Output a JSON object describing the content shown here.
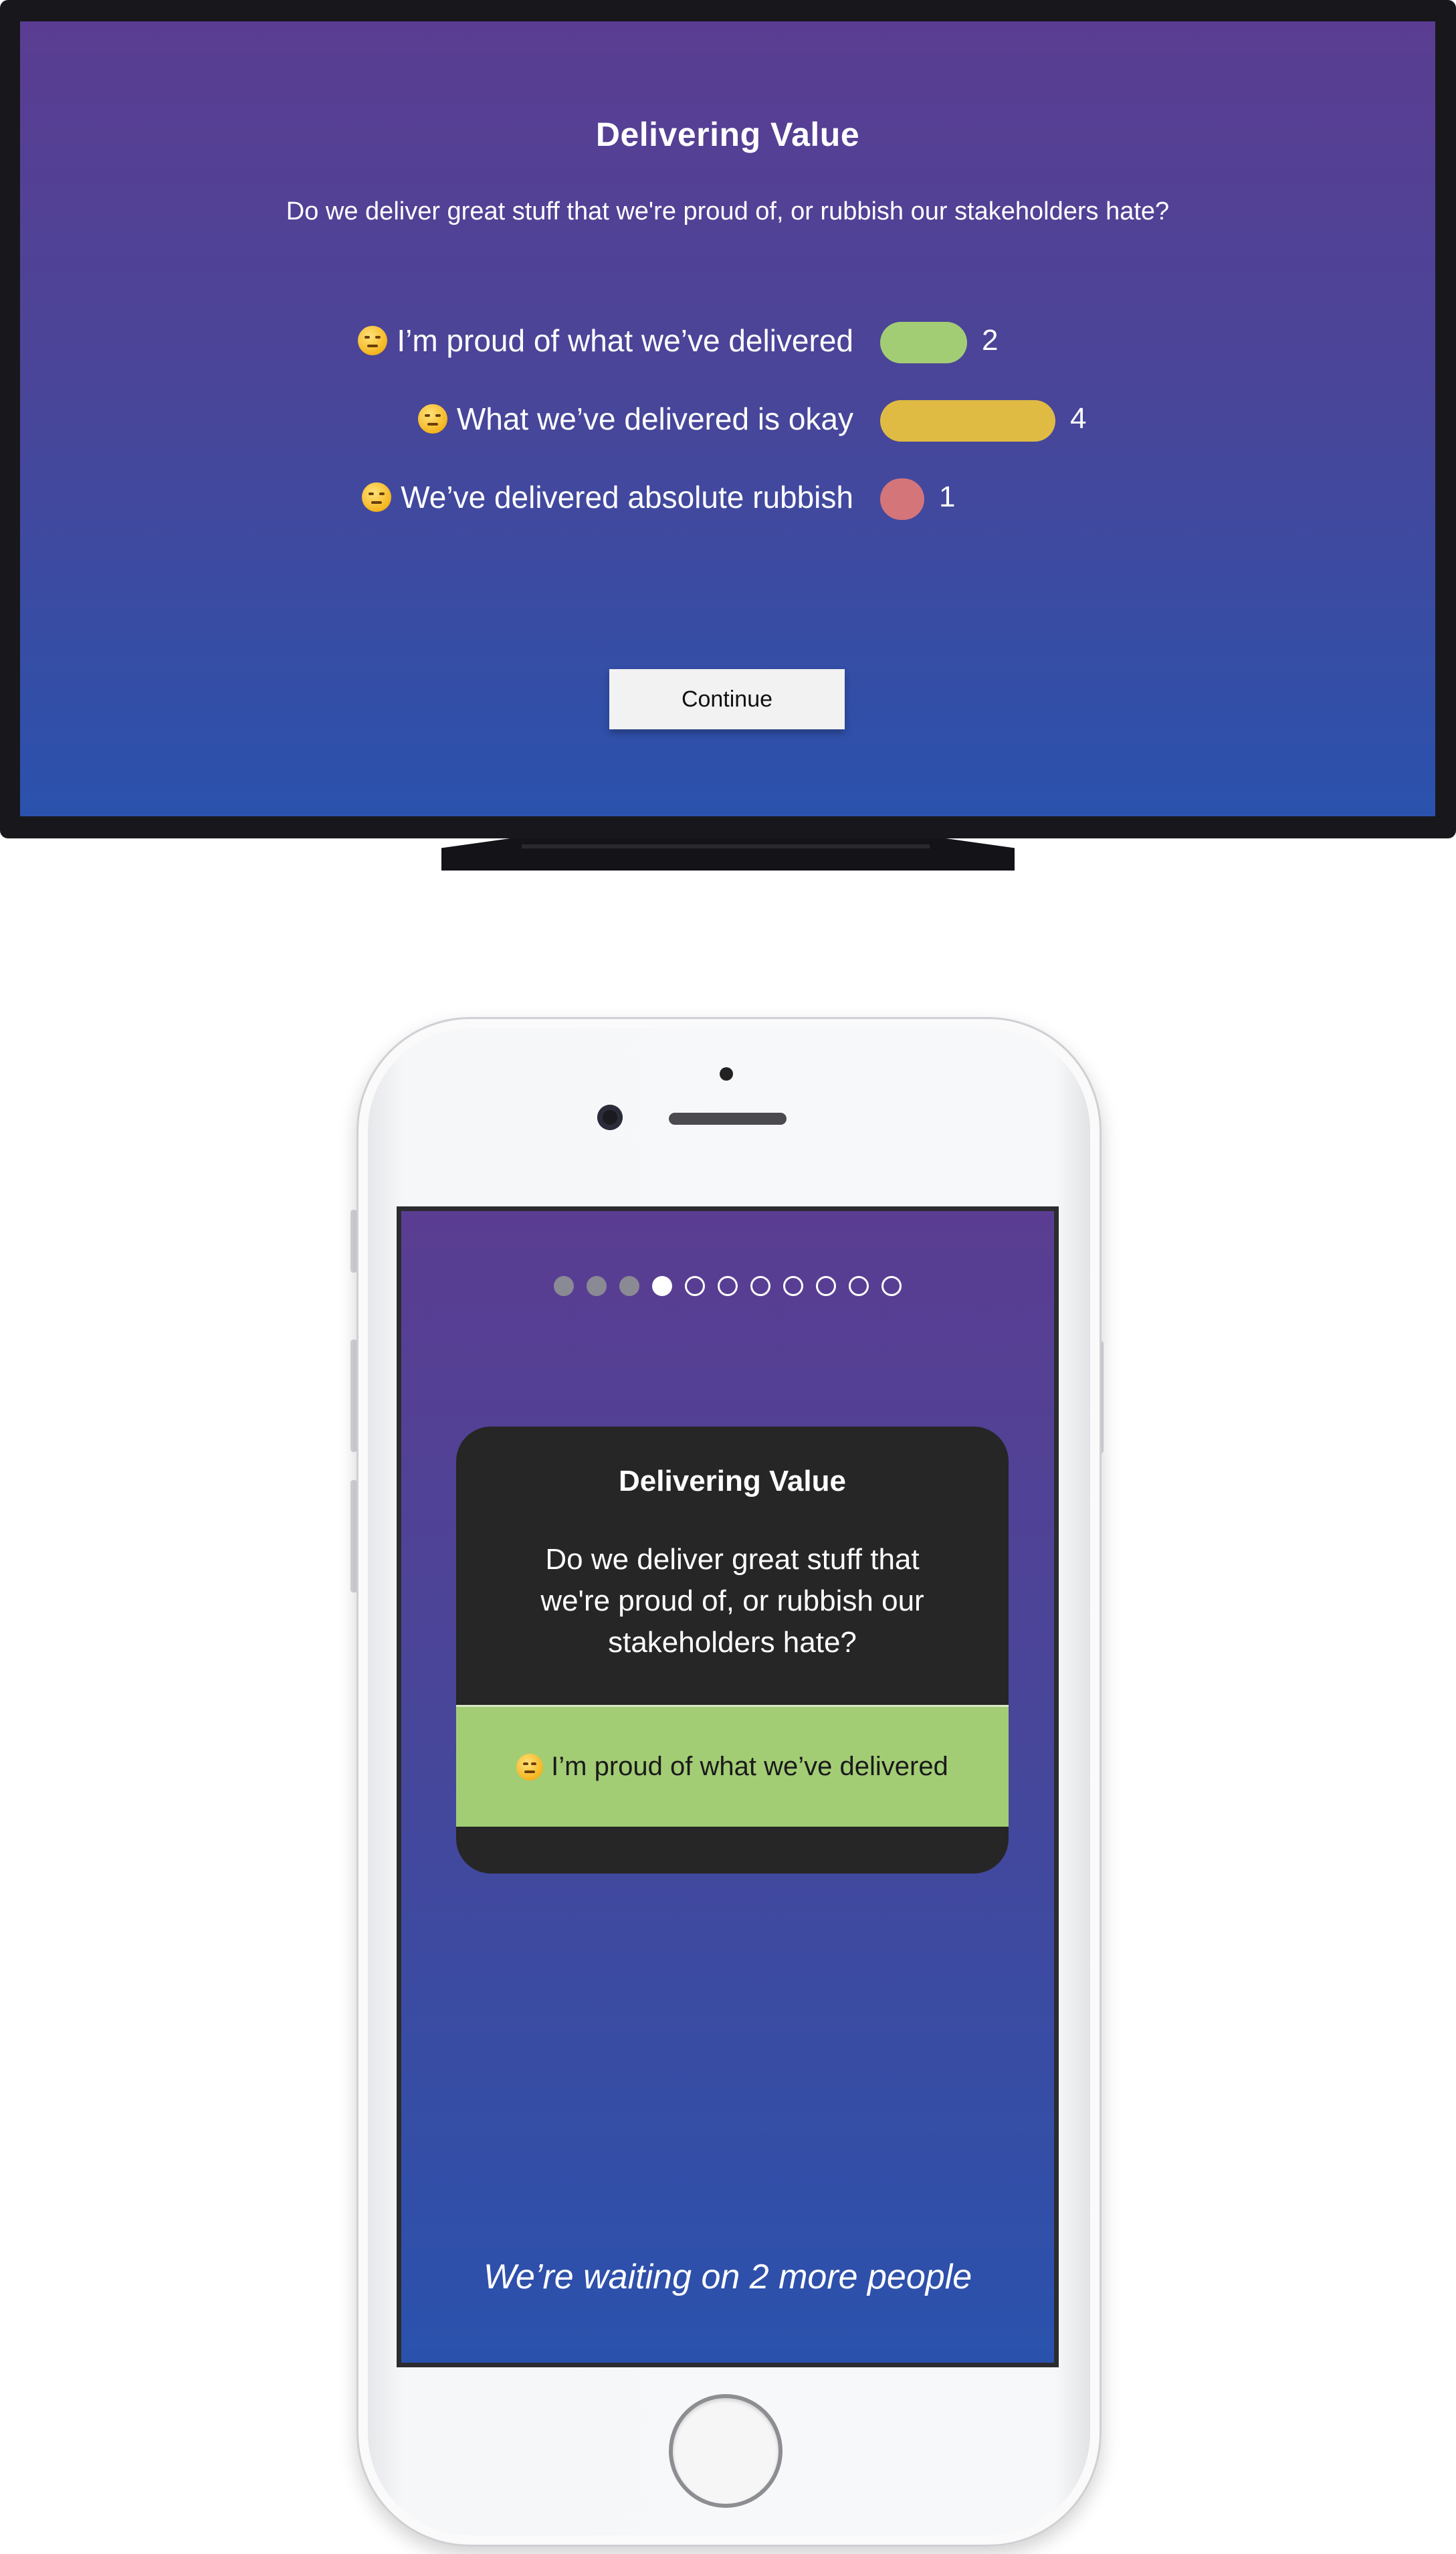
{
  "tv": {
    "title": "Delivering Value",
    "question": "Do we deliver great stuff that we're proud of, or rubbish our stakeholders hate?",
    "results": [
      {
        "label": "I’m proud of what we’ve delivered",
        "count": "2",
        "color": "#a3cd75",
        "icon": "relieved-face-emoji"
      },
      {
        "label": "What we’ve delivered is okay",
        "count": "4",
        "color": "#e0bb44",
        "icon": "neutral-face-emoji"
      },
      {
        "label": "We’ve delivered absolute rubbish",
        "count": "1",
        "color": "#d4757a",
        "icon": "unamused-face-emoji"
      }
    ],
    "continue_label": "Continue"
  },
  "phone": {
    "progress": {
      "total": 11,
      "completed": 3,
      "current": 4
    },
    "card": {
      "title": "Delivering Value",
      "question": "Do we deliver great stuff that we're proud of, or rubbish our stakeholders hate?",
      "selected_answer": "I’m proud of what we’ve delivered",
      "selected_icon": "relieved-face-emoji",
      "selected_color": "#a3cd75"
    },
    "waiting_text": "We’re waiting on 2 more people"
  },
  "colors": {
    "gradient_top": "#5a3d92",
    "gradient_bottom": "#2a52ad",
    "card_bg": "#262626"
  }
}
